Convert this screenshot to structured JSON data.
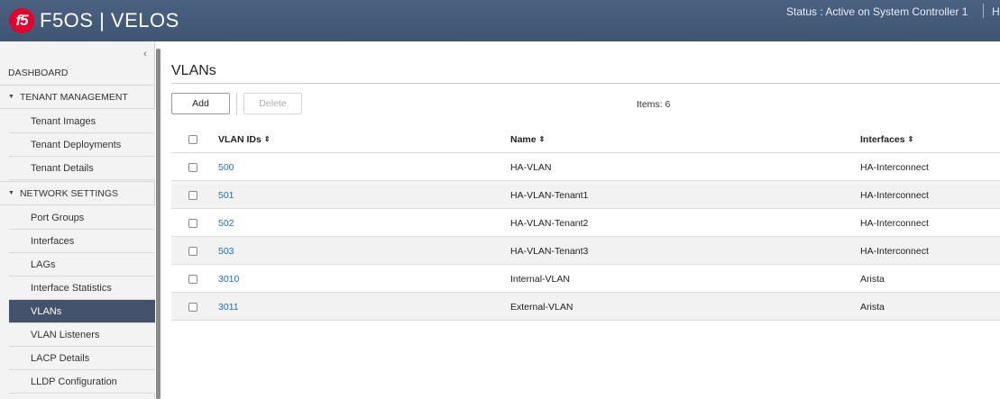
{
  "header": {
    "logo_text": "f5",
    "product": "F5OS | VELOS",
    "status": "Status : Active on System Controller 1",
    "host_label": "Hos"
  },
  "sidebar": {
    "collapse_icon": "‹",
    "dashboard": "DASHBOARD",
    "sections": [
      {
        "label": "TENANT MANAGEMENT",
        "items": [
          "Tenant Images",
          "Tenant Deployments",
          "Tenant Details"
        ]
      },
      {
        "label": "NETWORK SETTINGS",
        "items": [
          "Port Groups",
          "Interfaces",
          "LAGs",
          "Interface Statistics",
          "VLANs",
          "VLAN Listeners",
          "LACP Details",
          "LLDP Configuration"
        ]
      }
    ],
    "active_item": "VLANs"
  },
  "main": {
    "title": "VLANs",
    "add_label": "Add",
    "delete_label": "Delete",
    "items_count": "Items: 6",
    "columns": {
      "id": "VLAN IDs",
      "name": "Name",
      "interfaces": "Interfaces",
      "sort_glyph": "⇕"
    },
    "rows": [
      {
        "id": "500",
        "name": "HA-VLAN",
        "interfaces": "HA-Interconnect"
      },
      {
        "id": "501",
        "name": "HA-VLAN-Tenant1",
        "interfaces": "HA-Interconnect"
      },
      {
        "id": "502",
        "name": "HA-VLAN-Tenant2",
        "interfaces": "HA-Interconnect"
      },
      {
        "id": "503",
        "name": "HA-VLAN-Tenant3",
        "interfaces": "HA-Interconnect"
      },
      {
        "id": "3010",
        "name": "Internal-VLAN",
        "interfaces": "Arista"
      },
      {
        "id": "3011",
        "name": "External-VLAN",
        "interfaces": "Arista"
      }
    ]
  },
  "colors": {
    "header_bg": "#44607f",
    "f5_red": "#e4002b",
    "active_nav": "#44536b",
    "link": "#2a6db5"
  }
}
